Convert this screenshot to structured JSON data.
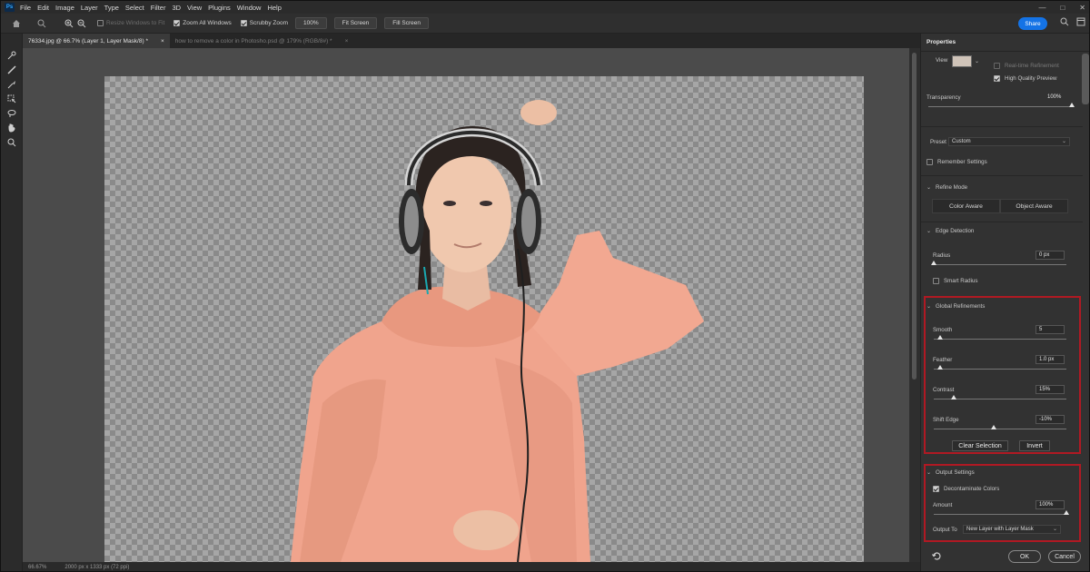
{
  "app": {
    "logo": "Ps"
  },
  "menu": [
    "File",
    "Edit",
    "Image",
    "Layer",
    "Type",
    "Select",
    "Filter",
    "3D",
    "View",
    "Plugins",
    "Window",
    "Help"
  ],
  "window_controls": [
    "—",
    "□",
    "✕"
  ],
  "options": {
    "resize_label": "Resize Windows to Fit",
    "zoom_all_label": "Zoom All Windows",
    "scrubby_label": "Scrubby Zoom",
    "zoom_value": "100%",
    "fit_screen": "Fit Screen",
    "fill_screen": "Fill Screen",
    "share": "Share"
  },
  "tabs": [
    {
      "label": "76334.jpg @ 66.7% (Layer 1, Layer Mask/8) *",
      "close": "×"
    },
    {
      "label": "how to remove a color in Photosho.psd @ 179% (RGB/8#) *",
      "close": "×"
    }
  ],
  "status": {
    "zoom": "66.67%",
    "dims": "2000 px x 1333 px (72 ppi)"
  },
  "panel": {
    "title": "Properties",
    "view_label": "View",
    "realtime_label": "Real-time Refinement",
    "hq_label": "High Quality Preview",
    "transparency_label": "Transparency",
    "transparency_value": "100%",
    "preset_label": "Preset",
    "preset_value": "Custom",
    "remember_label": "Remember Settings",
    "refine_mode_label": "Refine Mode",
    "color_aware": "Color Aware",
    "object_aware": "Object Aware",
    "edge_detection_label": "Edge Detection",
    "radius_label": "Radius",
    "radius_value": "0 px",
    "smart_radius_label": "Smart Radius",
    "global_label": "Global Refinements",
    "smooth_label": "Smooth",
    "smooth_value": "5",
    "feather_label": "Feather",
    "feather_value": "1.0 px",
    "contrast_label": "Contrast",
    "contrast_value": "15%",
    "shift_label": "Shift Edge",
    "shift_value": "-10%",
    "clear_selection": "Clear Selection",
    "invert": "Invert",
    "output_label": "Output Settings",
    "decontaminate_label": "Decontaminate Colors",
    "amount_label": "Amount",
    "amount_value": "100%",
    "output_to_label": "Output To",
    "output_to_value": "New Layer with Layer Mask",
    "ok": "OK",
    "cancel": "Cancel"
  },
  "slider_levels": {
    "transparency": 1.0,
    "radius": 0.0,
    "smooth": 0.05,
    "feather": 0.05,
    "contrast": 0.15,
    "shift": 0.45,
    "amount": 1.0
  },
  "colors": {
    "accent": "#1473e6",
    "highlight_box": "#b01923",
    "hoodie": "#f2a68f"
  }
}
